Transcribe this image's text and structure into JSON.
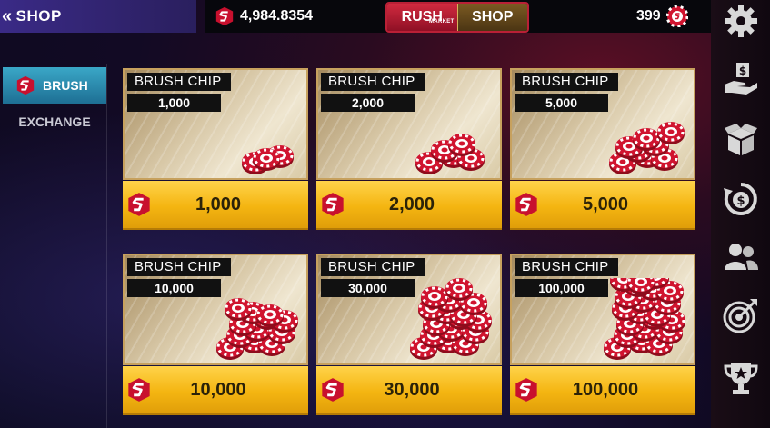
{
  "header": {
    "back_label": "SHOP",
    "balance": "4,984.8354",
    "tabs": [
      {
        "label": "RUSH",
        "sublabel": "MARKET"
      },
      {
        "label": "SHOP"
      }
    ],
    "chip_count": "399"
  },
  "nav": {
    "items": [
      {
        "label": "BRUSH",
        "icon": "brush-logo-icon"
      },
      {
        "label": "EXCHANGE"
      }
    ]
  },
  "products": [
    {
      "title": "BRUSH CHIP",
      "amount": "1,000",
      "price": "1,000"
    },
    {
      "title": "BRUSH CHIP",
      "amount": "2,000",
      "price": "2,000"
    },
    {
      "title": "BRUSH CHIP",
      "amount": "5,000",
      "price": "5,000"
    },
    {
      "title": "BRUSH CHIP",
      "amount": "10,000",
      "price": "10,000"
    },
    {
      "title": "BRUSH CHIP",
      "amount": "30,000",
      "price": "30,000"
    },
    {
      "title": "BRUSH CHIP",
      "amount": "100,000",
      "price": "100,000"
    }
  ],
  "rail_icons": [
    "settings-icon",
    "cash-hand-icon",
    "gift-box-icon",
    "refresh-coin-icon",
    "friends-icon",
    "target-icon",
    "trophy-icon"
  ],
  "colors": {
    "accent_red": "#c8102e",
    "gold": "#f4b511",
    "nav_active": "#2a8db5"
  }
}
